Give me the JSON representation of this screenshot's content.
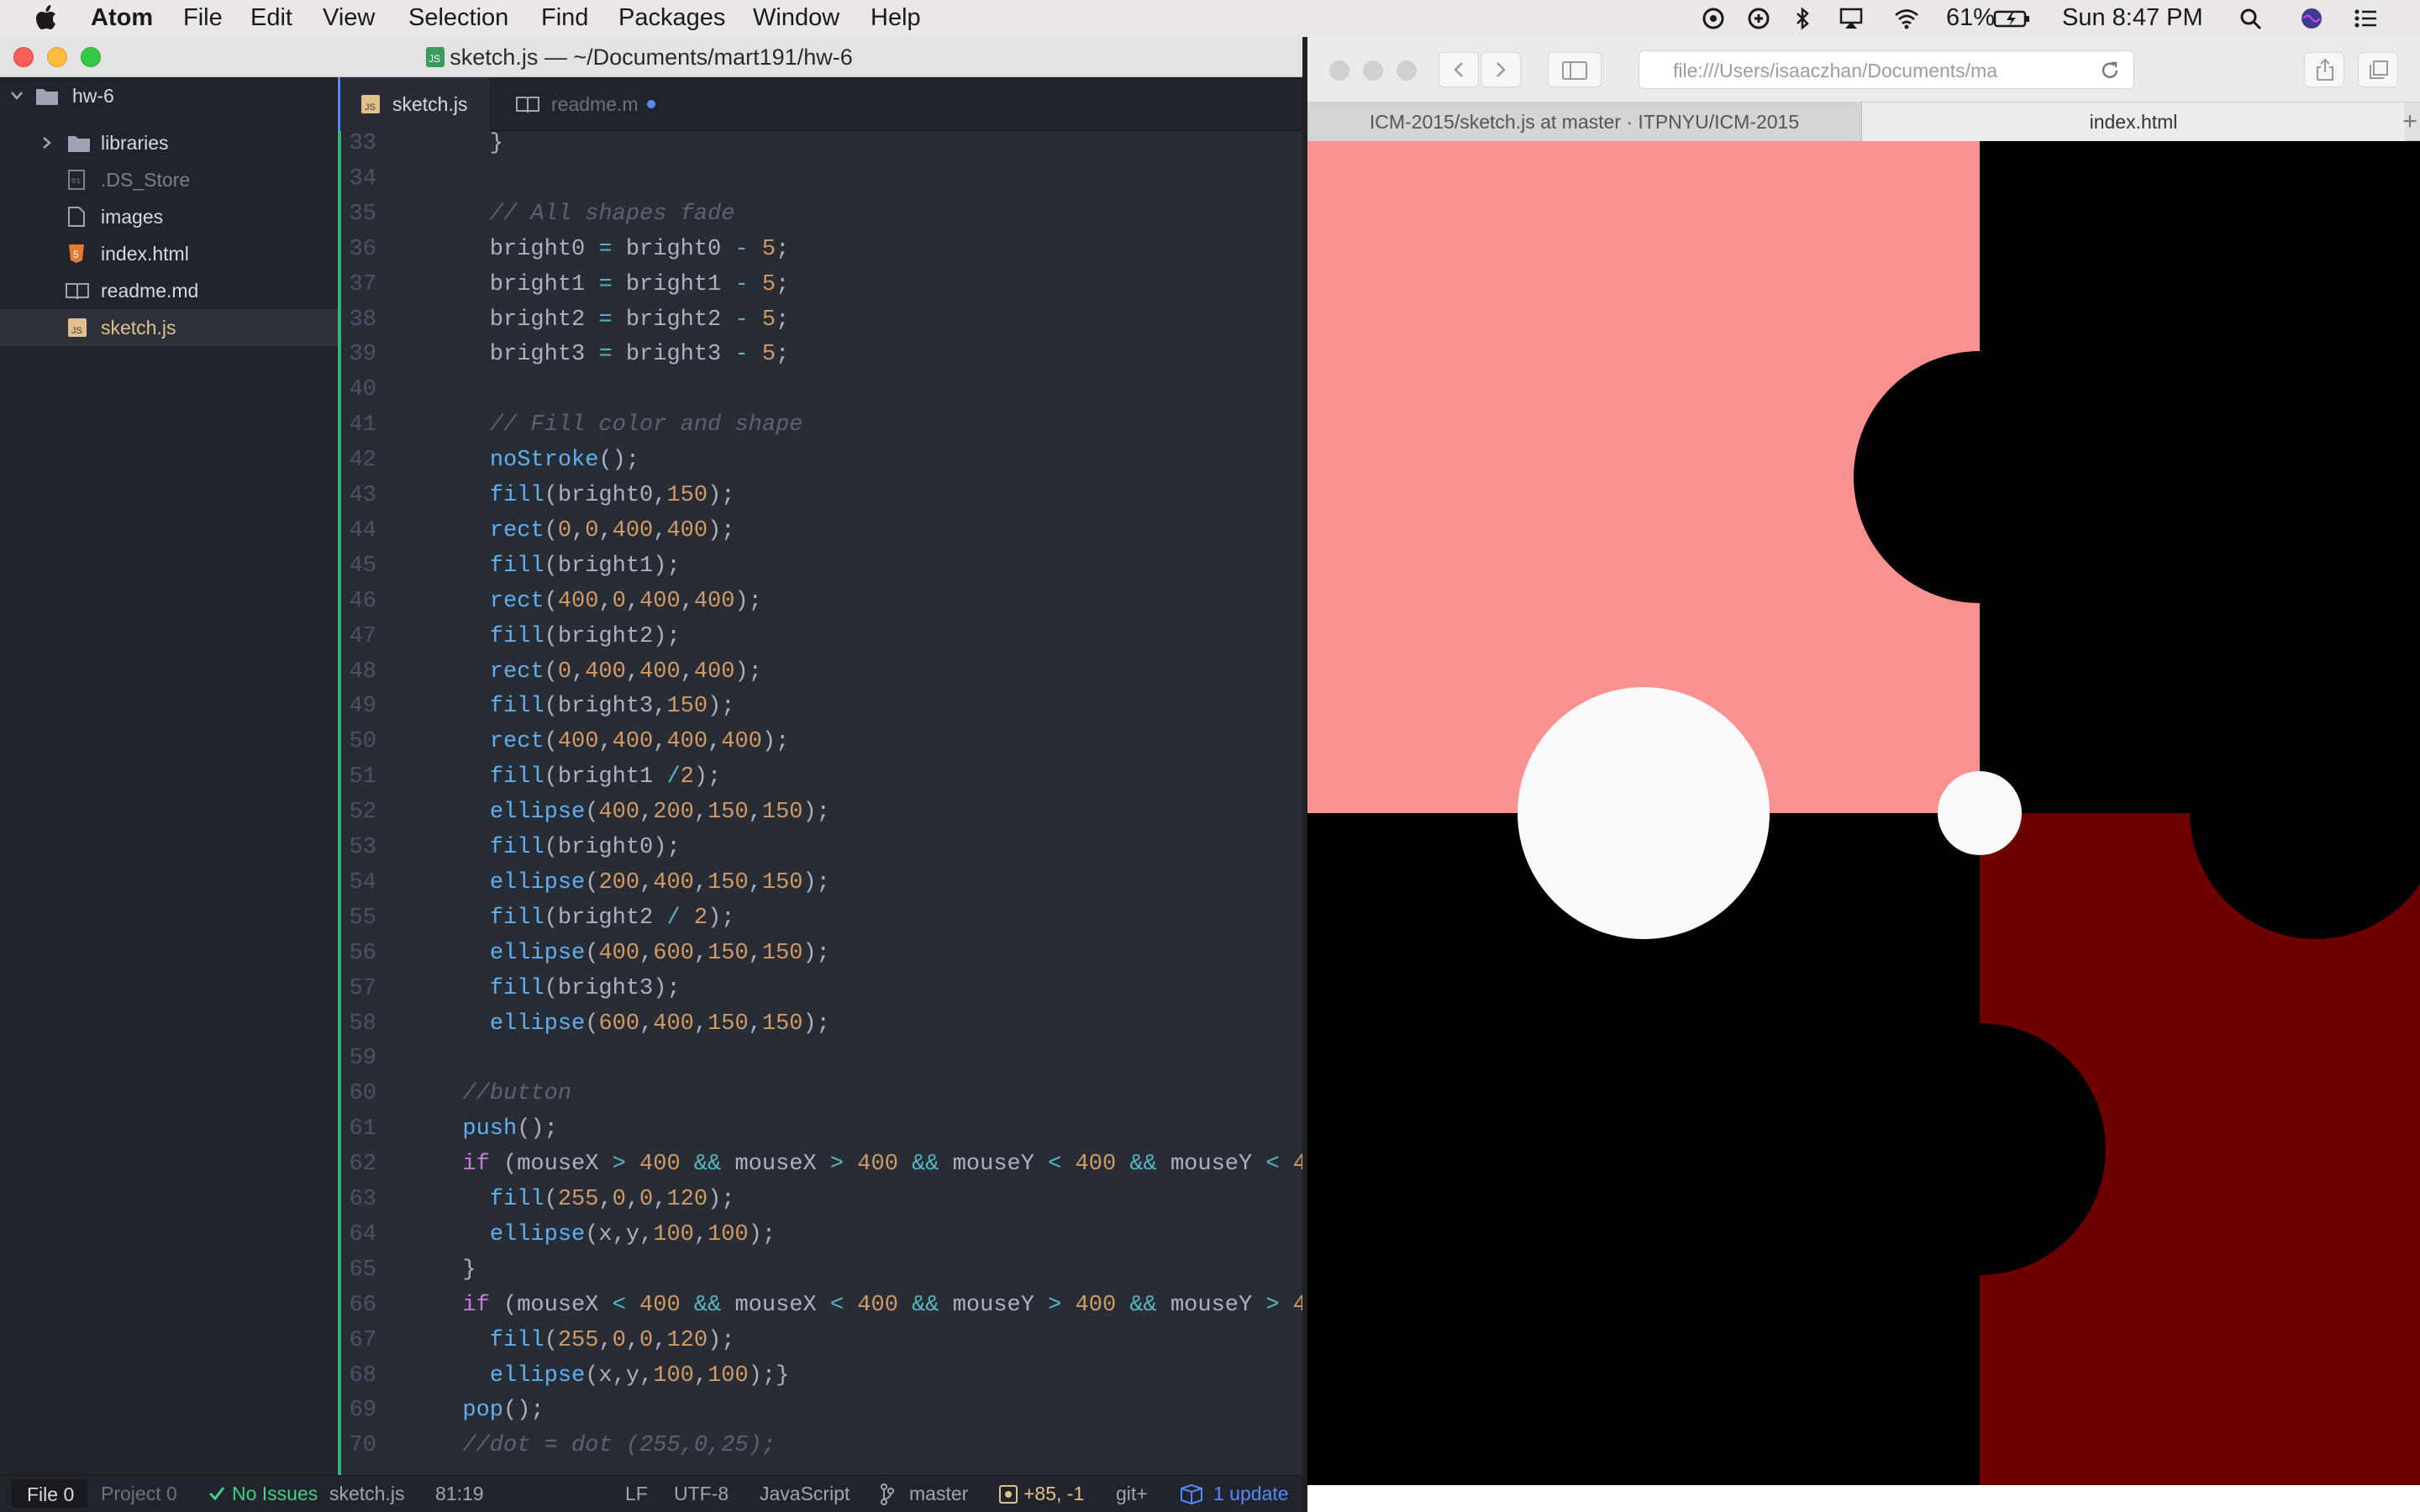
{
  "menubar": {
    "app": "Atom",
    "items": [
      "File",
      "Edit",
      "View",
      "Selection",
      "Find",
      "Packages",
      "Window",
      "Help"
    ],
    "battery": "61%",
    "clock": "Sun 8:47 PM"
  },
  "atom": {
    "window_title": "sketch.js — ~/Documents/mart191/hw-6",
    "tree": {
      "root": "hw-6",
      "items": [
        {
          "label": "libraries",
          "kind": "folder"
        },
        {
          "label": ".DS_Store",
          "kind": "file"
        },
        {
          "label": "images",
          "kind": "file"
        },
        {
          "label": "index.html",
          "kind": "html"
        },
        {
          "label": "readme.md",
          "kind": "md"
        },
        {
          "label": "sketch.js",
          "kind": "js"
        }
      ]
    },
    "tabs": [
      {
        "label": "sketch.js",
        "icon": "JS"
      },
      {
        "label": "readme.m",
        "icon": "md"
      }
    ],
    "status": {
      "file": "File",
      "file_count": "0",
      "project": "Project",
      "project_count": "0",
      "issues": "No Issues",
      "filename": "sketch.js",
      "cursor": "81:19",
      "line_ending": "LF",
      "encoding": "UTF-8",
      "grammar": "JavaScript",
      "branch": "master",
      "diff": "+85, -1",
      "git": "git+",
      "update": "1 update"
    }
  },
  "code_lines": [
    {
      "n": "33",
      "t": [
        [
          "vr",
          "    }"
        ]
      ]
    },
    {
      "n": "34",
      "t": []
    },
    {
      "n": "35",
      "t": [
        [
          "cm",
          "    // All shapes fade"
        ]
      ]
    },
    {
      "n": "36",
      "t": [
        [
          "vr",
          "    bright0 "
        ],
        [
          "op",
          "="
        ],
        [
          "vr",
          " bright0 "
        ],
        [
          "op",
          "-"
        ],
        [
          "vr",
          " "
        ],
        [
          "num",
          "5"
        ],
        [
          "vr",
          ";"
        ]
      ]
    },
    {
      "n": "37",
      "t": [
        [
          "vr",
          "    bright1 "
        ],
        [
          "op",
          "="
        ],
        [
          "vr",
          " bright1 "
        ],
        [
          "op",
          "-"
        ],
        [
          "vr",
          " "
        ],
        [
          "num",
          "5"
        ],
        [
          "vr",
          ";"
        ]
      ]
    },
    {
      "n": "38",
      "t": [
        [
          "vr",
          "    bright2 "
        ],
        [
          "op",
          "="
        ],
        [
          "vr",
          " bright2 "
        ],
        [
          "op",
          "-"
        ],
        [
          "vr",
          " "
        ],
        [
          "num",
          "5"
        ],
        [
          "vr",
          ";"
        ]
      ]
    },
    {
      "n": "39",
      "t": [
        [
          "vr",
          "    bright3 "
        ],
        [
          "op",
          "="
        ],
        [
          "vr",
          " bright3 "
        ],
        [
          "op",
          "-"
        ],
        [
          "vr",
          " "
        ],
        [
          "num",
          "5"
        ],
        [
          "vr",
          ";"
        ]
      ]
    },
    {
      "n": "40",
      "t": []
    },
    {
      "n": "41",
      "t": [
        [
          "cm",
          "    // Fill color and shape"
        ]
      ]
    },
    {
      "n": "42",
      "t": [
        [
          "vr",
          "    "
        ],
        [
          "fn",
          "noStroke"
        ],
        [
          "vr",
          "();"
        ]
      ]
    },
    {
      "n": "43",
      "t": [
        [
          "vr",
          "    "
        ],
        [
          "fn",
          "fill"
        ],
        [
          "vr",
          "(bright0,"
        ],
        [
          "num",
          "150"
        ],
        [
          "vr",
          ");"
        ]
      ]
    },
    {
      "n": "44",
      "t": [
        [
          "vr",
          "    "
        ],
        [
          "fn",
          "rect"
        ],
        [
          "vr",
          "("
        ],
        [
          "num",
          "0"
        ],
        [
          "vr",
          ","
        ],
        [
          "num",
          "0"
        ],
        [
          "vr",
          ","
        ],
        [
          "num",
          "400"
        ],
        [
          "vr",
          ","
        ],
        [
          "num",
          "400"
        ],
        [
          "vr",
          ");"
        ]
      ]
    },
    {
      "n": "45",
      "t": [
        [
          "vr",
          "    "
        ],
        [
          "fn",
          "fill"
        ],
        [
          "vr",
          "(bright1);"
        ]
      ]
    },
    {
      "n": "46",
      "t": [
        [
          "vr",
          "    "
        ],
        [
          "fn",
          "rect"
        ],
        [
          "vr",
          "("
        ],
        [
          "num",
          "400"
        ],
        [
          "vr",
          ","
        ],
        [
          "num",
          "0"
        ],
        [
          "vr",
          ","
        ],
        [
          "num",
          "400"
        ],
        [
          "vr",
          ","
        ],
        [
          "num",
          "400"
        ],
        [
          "vr",
          ");"
        ]
      ]
    },
    {
      "n": "47",
      "t": [
        [
          "vr",
          "    "
        ],
        [
          "fn",
          "fill"
        ],
        [
          "vr",
          "(bright2);"
        ]
      ]
    },
    {
      "n": "48",
      "t": [
        [
          "vr",
          "    "
        ],
        [
          "fn",
          "rect"
        ],
        [
          "vr",
          "("
        ],
        [
          "num",
          "0"
        ],
        [
          "vr",
          ","
        ],
        [
          "num",
          "400"
        ],
        [
          "vr",
          ","
        ],
        [
          "num",
          "400"
        ],
        [
          "vr",
          ","
        ],
        [
          "num",
          "400"
        ],
        [
          "vr",
          ");"
        ]
      ]
    },
    {
      "n": "49",
      "t": [
        [
          "vr",
          "    "
        ],
        [
          "fn",
          "fill"
        ],
        [
          "vr",
          "(bright3,"
        ],
        [
          "num",
          "150"
        ],
        [
          "vr",
          ");"
        ]
      ]
    },
    {
      "n": "50",
      "t": [
        [
          "vr",
          "    "
        ],
        [
          "fn",
          "rect"
        ],
        [
          "vr",
          "("
        ],
        [
          "num",
          "400"
        ],
        [
          "vr",
          ","
        ],
        [
          "num",
          "400"
        ],
        [
          "vr",
          ","
        ],
        [
          "num",
          "400"
        ],
        [
          "vr",
          ","
        ],
        [
          "num",
          "400"
        ],
        [
          "vr",
          ");"
        ]
      ]
    },
    {
      "n": "51",
      "t": [
        [
          "vr",
          "    "
        ],
        [
          "fn",
          "fill"
        ],
        [
          "vr",
          "(bright1 "
        ],
        [
          "op",
          "/"
        ],
        [
          "num",
          "2"
        ],
        [
          "vr",
          ");"
        ]
      ]
    },
    {
      "n": "52",
      "t": [
        [
          "vr",
          "    "
        ],
        [
          "fn",
          "ellipse"
        ],
        [
          "vr",
          "("
        ],
        [
          "num",
          "400"
        ],
        [
          "vr",
          ","
        ],
        [
          "num",
          "200"
        ],
        [
          "vr",
          ","
        ],
        [
          "num",
          "150"
        ],
        [
          "vr",
          ","
        ],
        [
          "num",
          "150"
        ],
        [
          "vr",
          ");"
        ]
      ]
    },
    {
      "n": "53",
      "t": [
        [
          "vr",
          "    "
        ],
        [
          "fn",
          "fill"
        ],
        [
          "vr",
          "(bright0);"
        ]
      ]
    },
    {
      "n": "54",
      "t": [
        [
          "vr",
          "    "
        ],
        [
          "fn",
          "ellipse"
        ],
        [
          "vr",
          "("
        ],
        [
          "num",
          "200"
        ],
        [
          "vr",
          ","
        ],
        [
          "num",
          "400"
        ],
        [
          "vr",
          ","
        ],
        [
          "num",
          "150"
        ],
        [
          "vr",
          ","
        ],
        [
          "num",
          "150"
        ],
        [
          "vr",
          ");"
        ]
      ]
    },
    {
      "n": "55",
      "t": [
        [
          "vr",
          "    "
        ],
        [
          "fn",
          "fill"
        ],
        [
          "vr",
          "(bright2 "
        ],
        [
          "op",
          "/"
        ],
        [
          "vr",
          " "
        ],
        [
          "num",
          "2"
        ],
        [
          "vr",
          ");"
        ]
      ]
    },
    {
      "n": "56",
      "t": [
        [
          "vr",
          "    "
        ],
        [
          "fn",
          "ellipse"
        ],
        [
          "vr",
          "("
        ],
        [
          "num",
          "400"
        ],
        [
          "vr",
          ","
        ],
        [
          "num",
          "600"
        ],
        [
          "vr",
          ","
        ],
        [
          "num",
          "150"
        ],
        [
          "vr",
          ","
        ],
        [
          "num",
          "150"
        ],
        [
          "vr",
          ");"
        ]
      ]
    },
    {
      "n": "57",
      "t": [
        [
          "vr",
          "    "
        ],
        [
          "fn",
          "fill"
        ],
        [
          "vr",
          "(bright3);"
        ]
      ]
    },
    {
      "n": "58",
      "t": [
        [
          "vr",
          "    "
        ],
        [
          "fn",
          "ellipse"
        ],
        [
          "vr",
          "("
        ],
        [
          "num",
          "600"
        ],
        [
          "vr",
          ","
        ],
        [
          "num",
          "400"
        ],
        [
          "vr",
          ","
        ],
        [
          "num",
          "150"
        ],
        [
          "vr",
          ","
        ],
        [
          "num",
          "150"
        ],
        [
          "vr",
          ");"
        ]
      ]
    },
    {
      "n": "59",
      "t": []
    },
    {
      "n": "60",
      "t": [
        [
          "cm",
          "  //button"
        ]
      ]
    },
    {
      "n": "61",
      "t": [
        [
          "vr",
          "  "
        ],
        [
          "fn",
          "push"
        ],
        [
          "vr",
          "();"
        ]
      ]
    },
    {
      "n": "62",
      "t": [
        [
          "vr",
          "  "
        ],
        [
          "kw",
          "if"
        ],
        [
          "vr",
          " (mouseX "
        ],
        [
          "op",
          ">"
        ],
        [
          "vr",
          " "
        ],
        [
          "num",
          "400"
        ],
        [
          "vr",
          " "
        ],
        [
          "op",
          "&&"
        ],
        [
          "vr",
          " mouseX "
        ],
        [
          "op",
          ">"
        ],
        [
          "vr",
          " "
        ],
        [
          "num",
          "400"
        ],
        [
          "vr",
          " "
        ],
        [
          "op",
          "&&"
        ],
        [
          "vr",
          " mouseY "
        ],
        [
          "op",
          "<"
        ],
        [
          "vr",
          " "
        ],
        [
          "num",
          "400"
        ],
        [
          "vr",
          " "
        ],
        [
          "op",
          "&&"
        ],
        [
          "vr",
          " mouseY "
        ],
        [
          "op",
          "<"
        ],
        [
          "vr",
          " "
        ],
        [
          "num",
          "4"
        ]
      ]
    },
    {
      "n": "63",
      "t": [
        [
          "vr",
          "    "
        ],
        [
          "fn",
          "fill"
        ],
        [
          "vr",
          "("
        ],
        [
          "num",
          "255"
        ],
        [
          "vr",
          ","
        ],
        [
          "num",
          "0"
        ],
        [
          "vr",
          ","
        ],
        [
          "num",
          "0"
        ],
        [
          "vr",
          ","
        ],
        [
          "num",
          "120"
        ],
        [
          "vr",
          ");"
        ]
      ]
    },
    {
      "n": "64",
      "t": [
        [
          "vr",
          "    "
        ],
        [
          "fn",
          "ellipse"
        ],
        [
          "vr",
          "(x,y,"
        ],
        [
          "num",
          "100"
        ],
        [
          "vr",
          ","
        ],
        [
          "num",
          "100"
        ],
        [
          "vr",
          ");"
        ]
      ]
    },
    {
      "n": "65",
      "t": [
        [
          "vr",
          "  }"
        ]
      ]
    },
    {
      "n": "66",
      "t": [
        [
          "vr",
          "  "
        ],
        [
          "kw",
          "if"
        ],
        [
          "vr",
          " (mouseX "
        ],
        [
          "op",
          "<"
        ],
        [
          "vr",
          " "
        ],
        [
          "num",
          "400"
        ],
        [
          "vr",
          " "
        ],
        [
          "op",
          "&&"
        ],
        [
          "vr",
          " mouseX "
        ],
        [
          "op",
          "<"
        ],
        [
          "vr",
          " "
        ],
        [
          "num",
          "400"
        ],
        [
          "vr",
          " "
        ],
        [
          "op",
          "&&"
        ],
        [
          "vr",
          " mouseY "
        ],
        [
          "op",
          ">"
        ],
        [
          "vr",
          " "
        ],
        [
          "num",
          "400"
        ],
        [
          "vr",
          " "
        ],
        [
          "op",
          "&&"
        ],
        [
          "vr",
          " mouseY "
        ],
        [
          "op",
          ">"
        ],
        [
          "vr",
          " "
        ],
        [
          "num",
          "4"
        ]
      ]
    },
    {
      "n": "67",
      "t": [
        [
          "vr",
          "    "
        ],
        [
          "fn",
          "fill"
        ],
        [
          "vr",
          "("
        ],
        [
          "num",
          "255"
        ],
        [
          "vr",
          ","
        ],
        [
          "num",
          "0"
        ],
        [
          "vr",
          ","
        ],
        [
          "num",
          "0"
        ],
        [
          "vr",
          ","
        ],
        [
          "num",
          "120"
        ],
        [
          "vr",
          ");"
        ]
      ]
    },
    {
      "n": "68",
      "t": [
        [
          "vr",
          "    "
        ],
        [
          "fn",
          "ellipse"
        ],
        [
          "vr",
          "(x,y,"
        ],
        [
          "num",
          "100"
        ],
        [
          "vr",
          ","
        ],
        [
          "num",
          "100"
        ],
        [
          "vr",
          ");}"
        ]
      ]
    },
    {
      "n": "69",
      "t": [
        [
          "vr",
          "  "
        ],
        [
          "fn",
          "pop"
        ],
        [
          "vr",
          "();"
        ]
      ]
    },
    {
      "n": "70",
      "t": [
        [
          "cm",
          "  //dot = dot (255,0,25);"
        ]
      ]
    }
  ],
  "safari": {
    "url": "file:///Users/isaaczhan/Documents/ma",
    "tabs": [
      "ICM-2015/sketch.js at master · ITPNYU/ICM-2015",
      "index.html"
    ],
    "new_tab": "+"
  },
  "colors": {
    "pink": "#fa9191",
    "dark_red": "#6e0000",
    "white": "#fafafa",
    "accent": "#528bff"
  }
}
